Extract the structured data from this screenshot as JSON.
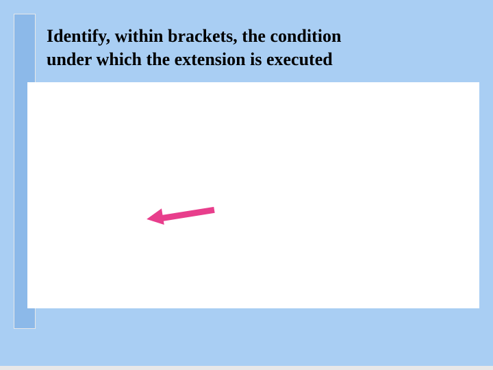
{
  "slide": {
    "title_line1": "Identify, within brackets, the condition",
    "title_line2": "under which the extension is executed"
  },
  "arrow": {
    "color": "#e83e8c",
    "direction": "left"
  },
  "theme": {
    "background": "#a9cef3",
    "accent_bar": "#8cb9e9",
    "panel": "#ffffff"
  }
}
